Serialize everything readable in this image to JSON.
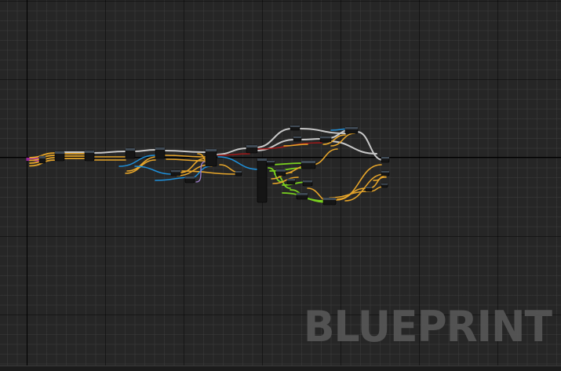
{
  "editor": {
    "watermark": "BLUEPRINT"
  },
  "colors": {
    "background": "#262626",
    "exec_wire": "#c8c8c8",
    "float_wire": "#e6a52a",
    "object_wire": "#1f8fd9",
    "bool_wire": "#a01818",
    "vector_wire": "#f2c02a",
    "struct_wire": "#7ad11f",
    "rotator_wire": "#a080d0",
    "delegate_wire": "#c02ac0",
    "node_body": "#151515",
    "node_header": "#3f4a55"
  },
  "icons": {
    "node": "blueprint-node-icon",
    "watermark": "blueprint-watermark"
  }
}
